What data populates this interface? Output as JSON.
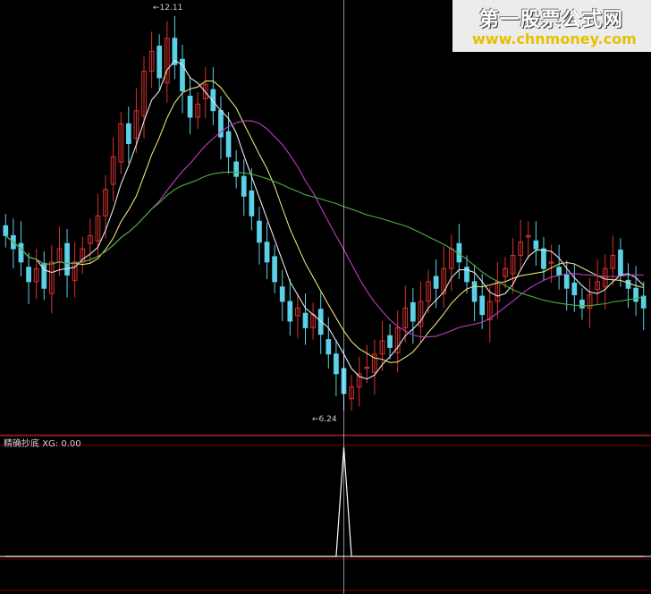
{
  "watermark": {
    "title": "第一股票公式网",
    "url": "www.chnmoney.com"
  },
  "annotations": {
    "high": "12.11",
    "low": "6.24"
  },
  "indicator": {
    "name": "精确抄底",
    "readout": "XG: 0.00"
  },
  "colors": {
    "up": "#d8312e",
    "down": "#5ad1e6",
    "ma5": "#e8e8e8",
    "ma10": "#e6e07a",
    "ma20": "#c13cc4",
    "ma60": "#48b040",
    "grid": "#7a0000",
    "cursor": "#ffffff",
    "indicator_line": "#ffffff",
    "baseline": "#ffffff"
  },
  "chart_data": [
    {
      "type": "candlestick",
      "ylim": [
        5.9,
        12.4
      ],
      "highest": 12.11,
      "lowest": 6.24,
      "series_closes": [
        8.9,
        8.7,
        8.5,
        8.2,
        8.4,
        8.1,
        8.5,
        8.7,
        8.3,
        8.5,
        8.7,
        8.9,
        9.2,
        9.6,
        10.1,
        10.6,
        10.3,
        10.8,
        11.4,
        11.7,
        11.3,
        11.9,
        11.5,
        11.1,
        10.7,
        10.9,
        11.2,
        10.8,
        10.4,
        10.1,
        9.8,
        9.5,
        9.2,
        8.8,
        8.5,
        8.2,
        7.9,
        7.6,
        7.8,
        7.5,
        7.7,
        7.4,
        7.1,
        6.8,
        6.5,
        6.6,
        6.8,
        6.9,
        7.1,
        7.3,
        7.2,
        7.5,
        7.8,
        7.6,
        7.9,
        8.2,
        8.1,
        8.4,
        8.7,
        8.5,
        8.2,
        7.9,
        7.7,
        7.9,
        8.2,
        8.4,
        8.6,
        8.8,
        8.9,
        8.7,
        8.4,
        8.5,
        8.3,
        8.1,
        8.0,
        7.8,
        8.0,
        8.2,
        8.4,
        8.6,
        8.3,
        8.1,
        7.9,
        7.8
      ]
    },
    {
      "type": "line",
      "series": [
        {
          "values": [
            0,
            0,
            0,
            0,
            0,
            0,
            0,
            0,
            0,
            0,
            0,
            0,
            0,
            0,
            0,
            0,
            0,
            0,
            0,
            0,
            0,
            0,
            0,
            0,
            0,
            0,
            0,
            0,
            0,
            0,
            0,
            0,
            0,
            0,
            0,
            0,
            0,
            0,
            0,
            0,
            0,
            0,
            0,
            0,
            1,
            0,
            0,
            0,
            0,
            0,
            0,
            0,
            0,
            0,
            0,
            0,
            0,
            0,
            0,
            0,
            0,
            0,
            0,
            0,
            0,
            0,
            0,
            0,
            0,
            0,
            0,
            0,
            0,
            0,
            0,
            0,
            0,
            0,
            0,
            0,
            0,
            0,
            0,
            0
          ]
        }
      ],
      "ylim": [
        0,
        1
      ]
    }
  ]
}
